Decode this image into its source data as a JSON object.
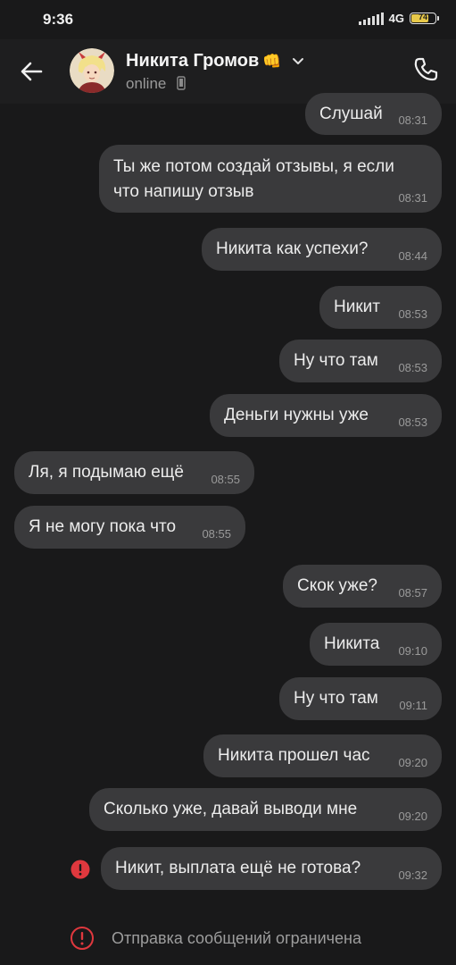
{
  "status_bar": {
    "time": "9:36",
    "network": "4G",
    "network_sub": "ıl",
    "battery": "74",
    "battery_level": 0.74
  },
  "header": {
    "contact_name": "Никита Громов",
    "name_emoji": "👊",
    "status": "online"
  },
  "messages": [
    {
      "text": "Слушай",
      "time": "08:31",
      "side": "out"
    },
    {
      "text": "Ты же потом создай отзывы, я если\nчто напишу отзыв",
      "time": "08:31",
      "side": "out"
    },
    {
      "text": "Никита как успехи?",
      "time": "08:44",
      "side": "out"
    },
    {
      "text": "Никит",
      "time": "08:53",
      "side": "out"
    },
    {
      "text": "Ну что там",
      "time": "08:53",
      "side": "out"
    },
    {
      "text": "Деньги нужны уже",
      "time": "08:53",
      "side": "out"
    },
    {
      "text": "Ля, я подымаю ещё",
      "time": "08:55",
      "side": "in"
    },
    {
      "text": "Я не могу пока что",
      "time": "08:55",
      "side": "in"
    },
    {
      "text": "Скок уже?",
      "time": "08:57",
      "side": "out"
    },
    {
      "text": "Никита",
      "time": "09:10",
      "side": "out"
    },
    {
      "text": "Ну что там",
      "time": "09:11",
      "side": "out"
    },
    {
      "text": "Никита прошел час",
      "time": "09:20",
      "side": "out"
    },
    {
      "text": "Сколько уже, давай выводи мне",
      "time": "09:20",
      "side": "out"
    },
    {
      "text": "Никит, выплата ещё не готова?",
      "time": "09:32",
      "side": "out",
      "failed": true
    }
  ],
  "notice": {
    "text": "Отправка сообщений ограничена"
  },
  "colors": {
    "background": "#19191a",
    "bubble": "#3a3a3c",
    "error": "#e0383e",
    "battery": "#e8c94a"
  },
  "icons": {
    "back": "arrow-left-icon",
    "chevron": "chevron-down-icon",
    "call": "phone-icon",
    "error": "alert-circle-icon"
  }
}
